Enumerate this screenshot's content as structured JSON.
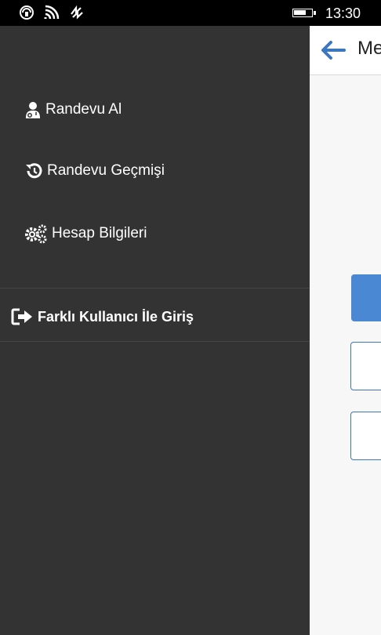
{
  "status_bar": {
    "time": "13:30",
    "icons": [
      "nfc-icon",
      "wifi-icon",
      "signal-icon",
      "battery-icon"
    ]
  },
  "page": {
    "title": "Me",
    "back_icon": "back-arrow-icon"
  },
  "drawer": {
    "items": [
      {
        "label": "Randevu Al",
        "icon": "doctor-icon"
      },
      {
        "label": "Randevu Geçmişi",
        "icon": "history-icon"
      },
      {
        "label": "Hesap Bilgileri",
        "icon": "gears-icon"
      }
    ],
    "logout": {
      "label": "Farklı Kullanıcı İle Giriş",
      "icon": "sign-out-icon"
    }
  },
  "colors": {
    "drawer_bg": "#333333",
    "accent_blue": "#4a88d4",
    "status_bar_bg": "#000000"
  }
}
